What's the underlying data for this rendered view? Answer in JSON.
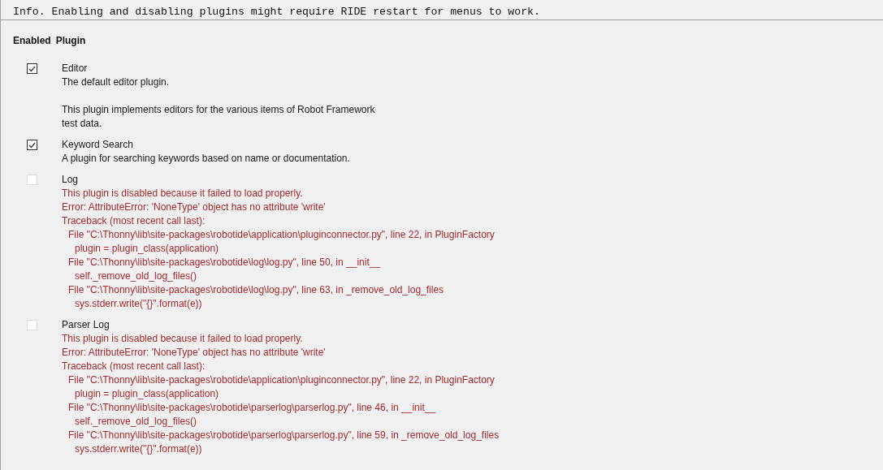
{
  "info": "Info. Enabling and disabling plugins might require RIDE restart for menus to work.",
  "columns": [
    "Enabled",
    "Plugin"
  ],
  "plugins": [
    {
      "name": "Editor",
      "enabled": true,
      "failed": false,
      "paragraphs": [
        [
          {
            "kind": "text",
            "text": "The default editor plugin."
          }
        ],
        [
          {
            "kind": "text",
            "text": "This plugin implements editors for the various items of Robot Framework"
          },
          {
            "kind": "text",
            "text": "test data."
          }
        ]
      ]
    },
    {
      "name": "Keyword Search",
      "enabled": true,
      "failed": false,
      "paragraphs": [
        [
          {
            "kind": "text",
            "text": "A plugin for searching keywords based on name or documentation."
          }
        ]
      ]
    },
    {
      "name": "Log",
      "enabled": false,
      "failed": true,
      "paragraphs": [
        [
          {
            "kind": "text",
            "text": "This plugin is disabled because it failed to load properly."
          },
          {
            "kind": "text",
            "text": "Error: AttributeError: 'NoneType' object has no attribute 'write'"
          },
          {
            "kind": "text",
            "text": "Traceback (most recent call last):"
          },
          {
            "kind": "frame",
            "text": "File \"C:\\Thonny\\lib\\site-packages\\robotide\\application\\pluginconnector.py\", line 22, in PluginFactory"
          },
          {
            "kind": "code",
            "text": "plugin = plugin_class(application)"
          },
          {
            "kind": "frame",
            "text": "File \"C:\\Thonny\\lib\\site-packages\\robotide\\log\\log.py\", line 50, in __init__"
          },
          {
            "kind": "code",
            "text": "self._remove_old_log_files()"
          },
          {
            "kind": "frame",
            "text": "File \"C:\\Thonny\\lib\\site-packages\\robotide\\log\\log.py\", line 63, in _remove_old_log_files"
          },
          {
            "kind": "code",
            "text": "sys.stderr.write(\"{}\".format(e))"
          }
        ]
      ]
    },
    {
      "name": "Parser Log",
      "enabled": false,
      "failed": true,
      "paragraphs": [
        [
          {
            "kind": "text",
            "text": "This plugin is disabled because it failed to load properly."
          },
          {
            "kind": "text",
            "text": "Error: AttributeError: 'NoneType' object has no attribute 'write'"
          },
          {
            "kind": "text",
            "text": "Traceback (most recent call last):"
          },
          {
            "kind": "frame",
            "text": "File \"C:\\Thonny\\lib\\site-packages\\robotide\\application\\pluginconnector.py\", line 22, in PluginFactory"
          },
          {
            "kind": "code",
            "text": "plugin = plugin_class(application)"
          },
          {
            "kind": "frame",
            "text": "File \"C:\\Thonny\\lib\\site-packages\\robotide\\parserlog\\parserlog.py\", line 46, in __init__"
          },
          {
            "kind": "code",
            "text": "self._remove_old_log_files()"
          },
          {
            "kind": "frame",
            "text": "File \"C:\\Thonny\\lib\\site-packages\\robotide\\parserlog\\parserlog.py\", line 59, in _remove_old_log_files"
          },
          {
            "kind": "code",
            "text": "sys.stderr.write(\"{}\".format(e))"
          }
        ]
      ]
    }
  ]
}
